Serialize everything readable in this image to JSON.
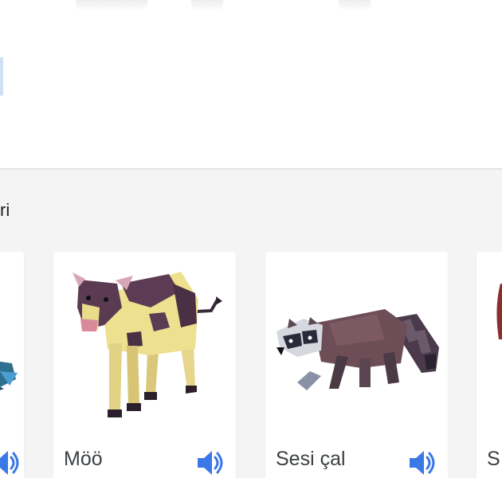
{
  "section": {
    "label": "ri"
  },
  "cards": [
    {
      "caption": ""
    },
    {
      "caption": "Möö"
    },
    {
      "caption": "Sesi çal"
    },
    {
      "caption": "S"
    }
  ],
  "colors": {
    "accent": "#3b78e7",
    "background": "#f4f4f4",
    "card": "#ffffff"
  },
  "icons": {
    "speaker": "speaker-icon"
  }
}
